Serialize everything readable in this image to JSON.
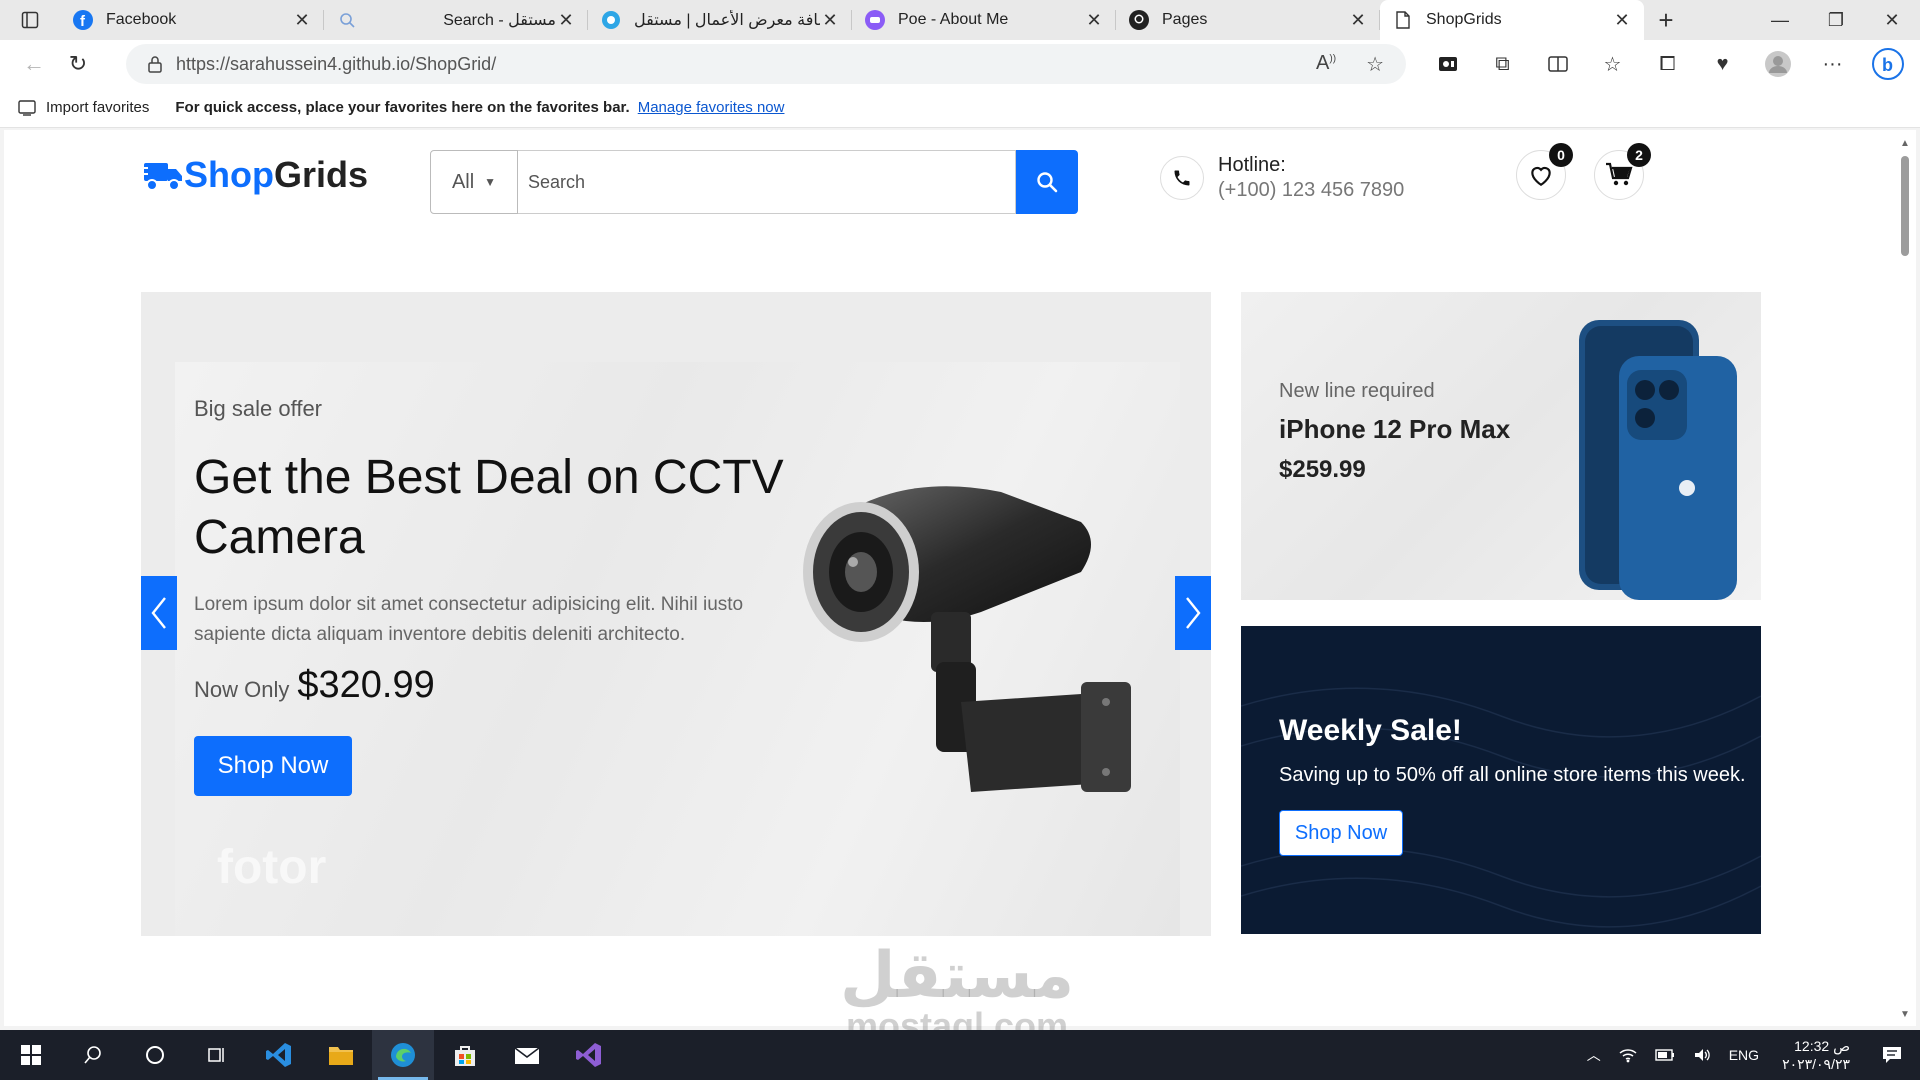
{
  "browser": {
    "tabs": [
      {
        "title": "Facebook",
        "icon": "facebook-icon",
        "active": false
      },
      {
        "title": "Search - مستقل",
        "icon": "search-icon",
        "active": false
      },
      {
        "title": "إضافة معرض الأعمال | مستقل",
        "icon": "mostaql-icon",
        "active": false
      },
      {
        "title": "Poe - About Me",
        "icon": "poe-icon",
        "active": false
      },
      {
        "title": "Pages",
        "icon": "github-icon",
        "active": false
      },
      {
        "title": "ShopGrids",
        "icon": "page-icon",
        "active": true
      }
    ],
    "url": "https://sarahussein4.github.io/ShopGrid/",
    "favorites_bar": {
      "import_label": "Import favorites",
      "message": "For quick access, place your favorites here on the favorites bar.",
      "manage_link": "Manage favorites now"
    }
  },
  "site": {
    "logo_part1": "Shop",
    "logo_part2": "Grids",
    "search": {
      "category": "All",
      "placeholder": "Search"
    },
    "hotline": {
      "label": "Hotline:",
      "phone": "(+100) 123 456 7890"
    },
    "wishlist_count": "0",
    "cart_count": "2",
    "hero": {
      "kicker": "Big sale offer",
      "title": "Get the Best Deal on CCTV Camera",
      "description": "Lorem ipsum dolor sit amet consectetur adipisicing elit. Nihil iusto sapiente dicta aliquam inventore debitis deleniti architecto.",
      "price_label": "Now Only",
      "price": "$320.99",
      "button": "Shop Now",
      "image_watermark": "fotor"
    },
    "banner_product": {
      "kicker": "New line required",
      "name": "iPhone 12 Pro Max",
      "price": "$259.99"
    },
    "banner_sale": {
      "title": "Weekly Sale!",
      "subtitle": "Saving up to 50% off all online store items this week.",
      "button": "Shop Now"
    },
    "page_watermark": {
      "arabic": "مستقل",
      "latin": "mostaql.com"
    }
  },
  "taskbar": {
    "language": "ENG",
    "time": "12:32 ص",
    "date": "٢٠٢٣/٠٩/٢٣"
  },
  "colors": {
    "accent": "#0d6efd",
    "dark_banner": "#0b1b33",
    "taskbar": "#1b1f29"
  }
}
